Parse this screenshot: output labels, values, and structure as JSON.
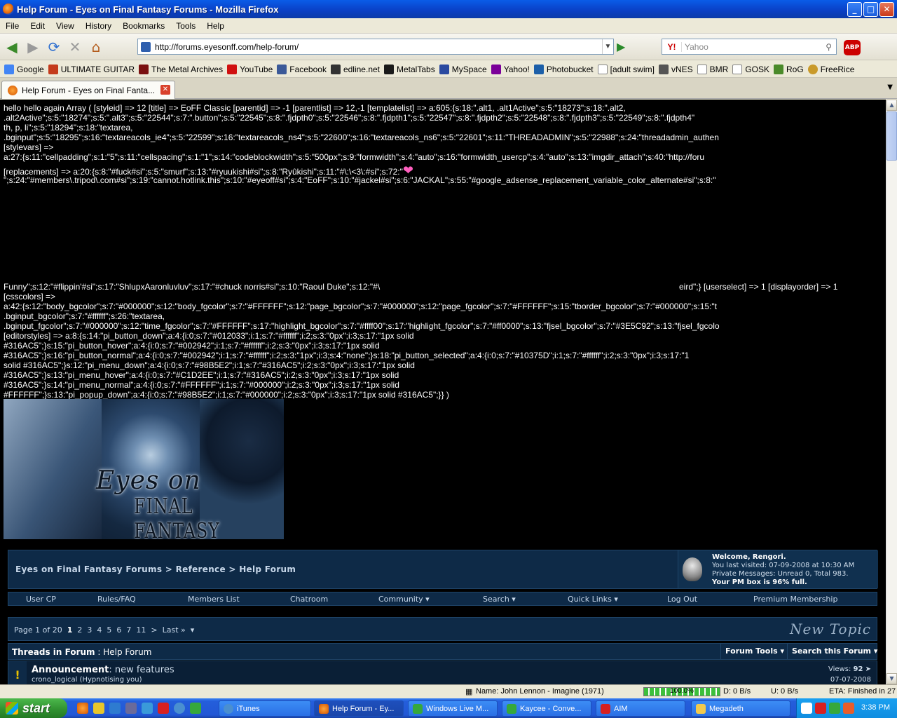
{
  "window": {
    "title": "Help Forum - Eyes on Final Fantasy Forums - Mozilla Firefox",
    "minimize": "_",
    "maximize": "□",
    "close": "✕"
  },
  "menu": [
    "File",
    "Edit",
    "View",
    "History",
    "Bookmarks",
    "Tools",
    "Help"
  ],
  "nav": {
    "url": "http://forums.eyesonff.com/help-forum/",
    "search_placeholder": "Yahoo",
    "search_engine": "Y!",
    "abp": "ABP"
  },
  "bookmarks": [
    "Google",
    "ULTIMATE GUITAR",
    "The Metal Archives",
    "YouTube",
    "Facebook",
    "edline.net",
    "MetalTabs",
    "MySpace",
    "Yahoo!",
    "Photobucket",
    "[adult swim]",
    "vNES",
    "BMR",
    "GOSK",
    "RoG",
    "FreeRice"
  ],
  "tab": {
    "title": "Help Forum - Eyes on Final Fanta..."
  },
  "dump": {
    "line1": "hello hello again Array ( [styleid] => 12 [title] => EoFF Classic [parentid] => -1 [parentlist] => 12,-1 [templatelist] => a:605:{s:18:\".alt1, .alt1Active\";s:5:\"18273\";s:18:\".alt2,",
    "line2": ".alt2Active\";s:5:\"18274\";s:5:\".alt3\";s:5:\"22544\";s:7:\".button\";s:5:\"22545\";s:8:\".fjdpth0\";s:5:\"22546\";s:8:\".fjdpth1\";s:5:\"22547\";s:8:\".fjdpth2\";s:5:\"22548\";s:8:\".fjdpth3\";s:5:\"22549\";s:8:\".fjdpth4\"",
    "line3": "th, p, li\";s:5:\"18294\";s:18:\"textarea,",
    "line4": ".bginput\";s:5:\"18295\";s:16:\"textareacols_ie4\";s:5:\"22599\";s:16:\"textareacols_ns4\";s:5:\"22600\";s:16:\"textareacols_ns6\";s:5:\"22601\";s:11:\"THREADADMIN\";s:5:\"22988\";s:24:\"threadadmin_authen",
    "line5": "[stylevars] =>",
    "line6": "a:27:{s:11:\"cellpadding\";s:1:\"5\";s:11:\"cellspacing\";s:1:\"1\";s:14:\"codeblockwidth\";s:5:\"500px\";s:9:\"formwidth\";s:4:\"auto\";s:16:\"formwidth_usercp\";s:4:\"auto\";s:13:\"imgdir_attach\";s:40:\"http://foru",
    "line7": "[replacements] => a:20:{s:8:\"#fuck#si\";s:5:\"smurf\";s:13:\"#ryuukishi#si\";s:8:\"Ryûkishi\";s:11:\"#\\:\\<3\\:#si\";s:72:\"",
    "line8": "\";s:24:\"#members\\.tripod\\.com#si\";s:19:\"cannot.hotlink.this\";s:10:\"#eyeoff#si\";s:4:\"EoFF\";s:10:\"#jackel#si\";s:6:\"JACKAL\";s:55:\"#google_adsense_replacement_variable_color_alternate#si\";s:8:\"",
    "line9a": "Funny\";s:12:\"#flippin'#si\";s:17:\"ShlupxAaronluvluv\";s:17:\"#chuck norris#si\";s:10:\"Raoul Duke\";s:12:\"#\\",
    "line9b": "eird\";} [userselect] => 1 [displayorder] => 1",
    "line10": "[csscolors] =>",
    "line11": "a:42:{s:12:\"body_bgcolor\";s:7:\"#000000\";s:12:\"body_fgcolor\";s:7:\"#FFFFFF\";s:12:\"page_bgcolor\";s:7:\"#000000\";s:12:\"page_fgcolor\";s:7:\"#FFFFFF\";s:15:\"tborder_bgcolor\";s:7:\"#000000\";s:15:\"t",
    "line12": ".bginput_bgcolor\";s:7:\"#ffffff\";s:26:\"textarea,",
    "line13": ".bginput_fgcolor\";s:7:\"#000000\";s:12:\"time_fgcolor\";s:7:\"#FFFFFF\";s:17:\"highlight_bgcolor\";s:7:\"#ffff00\";s:17:\"highlight_fgcolor\";s:7:\"#ff0000\";s:13:\"fjsel_bgcolor\";s:7:\"#3E5C92\";s:13:\"fjsel_fgcolo",
    "line14": "[editorstyles] => a:8:{s:14:\"pi_button_down\";a:4:{i:0;s:7:\"#012033\";i:1;s:7:\"#ffffff\";i:2;s:3:\"0px\";i:3;s:17:\"1px solid",
    "line15": "#316AC5\";}s:15:\"pi_button_hover\";a:4:{i:0;s:7:\"#002942\";i:1;s:7:\"#ffffff\";i:2;s:3:\"0px\";i:3;s:17:\"1px solid",
    "line16": "#316AC5\";}s:16:\"pi_button_normal\";a:4:{i:0;s:7:\"#002942\";i:1;s:7:\"#ffffff\";i:2;s:3:\"1px\";i:3;s:4:\"none\";}s:18:\"pi_button_selected\";a:4:{i:0;s:7:\"#10375D\";i:1;s:7:\"#ffffff\";i:2;s:3:\"0px\";i:3;s:17:\"1",
    "line17": "solid #316AC5\";}s:12:\"pi_menu_down\";a:4:{i:0;s:7:\"#98B5E2\";i:1;s:7:\"#316AC5\";i:2;s:3:\"0px\";i:3;s:17:\"1px solid",
    "line18": "#316AC5\";}s:13:\"pi_menu_hover\";a:4:{i:0;s:7:\"#C1D2EE\";i:1;s:7:\"#316AC5\";i:2;s:3:\"0px\";i:3;s:17:\"1px solid",
    "line19": "#316AC5\";}s:14:\"pi_menu_normal\";a:4:{i:0;s:7:\"#FFFFFF\";i:1;s:7:\"#000000\";i:2;s:3:\"0px\";i:3;s:17:\"1px solid",
    "line20": "#FFFFFF\";}s:13:\"pi_popup_down\";a:4:{i:0;s:7:\"#98B5E2\";i:1;s:7:\"#000000\";i:2;s:3:\"0px\";i:3;s:17:\"1px solid #316AC5\";}} )"
  },
  "banner": {
    "logo_line1": "Eyes on",
    "logo_line2": "FINAL FANTASY"
  },
  "breadcrumb": {
    "root": "Eyes on Final Fantasy Forums",
    "sep": ">",
    "section": "Reference",
    "current": "Help Forum"
  },
  "welcome": {
    "greeting": "Welcome,",
    "username": "Rengori.",
    "last_visited": "You last visited: 07-09-2008 at 10:30 AM",
    "pm": "Private Messages: Unread 0, Total 983.",
    "pm_box": "Your PM box is 96% full."
  },
  "mainnav": [
    "User CP",
    "Rules/FAQ",
    "Members List",
    "Chatroom",
    "Community ▾",
    "Search ▾",
    "Quick Links ▾",
    "Log Out",
    "Premium Membership"
  ],
  "pager": {
    "label": "Page 1 of 20",
    "current": "1",
    "pages": [
      "2",
      "3",
      "4",
      "5",
      "6",
      "7",
      "11"
    ],
    "next": ">",
    "last": "Last »",
    "dropdown": "▾"
  },
  "new_topic": "New Topic",
  "threads": {
    "heading": "Threads in Forum",
    "forum_name": ": Help Forum",
    "forum_tools": "Forum Tools ▾",
    "search_forum": "Search this Forum ▾"
  },
  "announcement": {
    "label": "Announcement",
    "title": ": new features",
    "author": "crono_logical (Hypnotising you)",
    "views_label": "Views:",
    "views": "92",
    "date": "07-07-2008"
  },
  "status": {
    "song": "Name: John Lennon - Imagine (1971)",
    "progress_value": 100,
    "progress_label": "100.0%",
    "down": "D: 0 B/s",
    "up": "U: 0 B/s",
    "eta": "ETA: Finished in 27"
  },
  "taskbar": {
    "start": "start",
    "tasks": [
      "iTunes",
      "Help Forum - Ey...",
      "Windows Live M...",
      "Kaycee - Conve...",
      "AIM",
      "Megadeth"
    ],
    "clock": "3:38 PM"
  },
  "colors": {
    "forum_bg": "#0e2a47",
    "forum_border": "#1f4468",
    "xp_blue": "#245edb",
    "start_green": "#2f8f2f"
  }
}
